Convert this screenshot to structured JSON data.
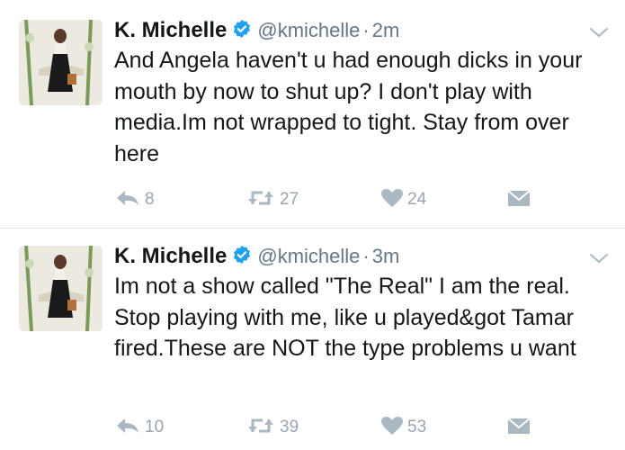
{
  "tweets": [
    {
      "name": "K. Michelle",
      "handle": "@kmichelle",
      "separator": "·",
      "time": "2m",
      "text": "And Angela haven't u had enough dicks in your mouth by now to shut up? I don't play with media.Im not wrapped to tight. Stay from over here",
      "replies": "8",
      "retweets": "27",
      "likes": "24"
    },
    {
      "name": "K. Michelle",
      "handle": "@kmichelle",
      "separator": "·",
      "time": "3m",
      "text": "Im not a show called \"The Real\" I am the real. Stop playing with me, like u played&got Tamar fired.These are NOT the type problems u want",
      "replies": "10",
      "retweets": "39",
      "likes": "53"
    }
  ],
  "colors": {
    "verified": "#1da1f2",
    "icon_gray": "#aab8c2",
    "divider": "#e1e8ed"
  },
  "icons": [
    "verified-badge-icon",
    "chevron-down-icon",
    "reply-icon",
    "retweet-icon",
    "heart-icon",
    "direct-message-icon"
  ]
}
